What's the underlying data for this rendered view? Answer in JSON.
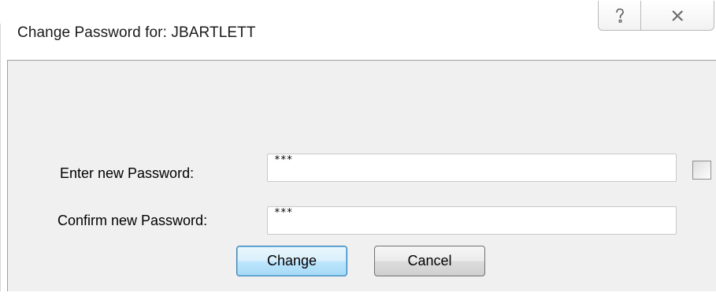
{
  "window": {
    "title": "Change Password for: JBARTLETT",
    "help_icon": "question-mark-icon",
    "close_icon": "close-x-icon"
  },
  "form": {
    "new_password_label": "Enter new Password:",
    "new_password_value": "***",
    "confirm_password_label": "Confirm new Password:",
    "confirm_password_value": "***",
    "show_password_checked": false
  },
  "buttons": {
    "change_label": "Change",
    "cancel_label": "Cancel"
  },
  "colors": {
    "client_background": "#f0f0f0",
    "default_button_border": "#3c7fb1"
  }
}
